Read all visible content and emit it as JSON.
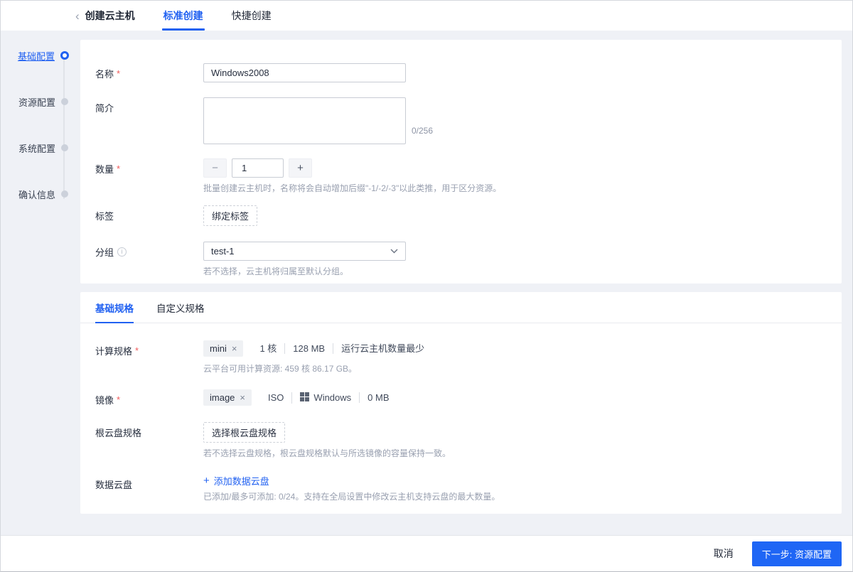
{
  "accent_color": "#2161f1",
  "required_mark": "*",
  "header": {
    "back_icon": "‹",
    "title": "创建云主机",
    "tabs": [
      {
        "label": "标准创建",
        "active": true
      },
      {
        "label": "快捷创建",
        "active": false
      }
    ]
  },
  "stepper": {
    "items": [
      {
        "label": "基础配置",
        "active": true
      },
      {
        "label": "资源配置",
        "active": false
      },
      {
        "label": "系统配置",
        "active": false
      },
      {
        "label": "确认信息",
        "active": false
      }
    ]
  },
  "form": {
    "name": {
      "label": "名称",
      "value": "Windows2008"
    },
    "description": {
      "label": "简介",
      "value": "",
      "counter": "0/256"
    },
    "quantity": {
      "label": "数量",
      "minus": "−",
      "value": "1",
      "plus": "+",
      "hint": "批量创建云主机时，名称将会自动增加后缀\"-1/-2/-3\"以此类推，用于区分资源。"
    },
    "tag": {
      "label": "标签",
      "button": "绑定标签"
    },
    "group": {
      "label": "分组",
      "info_icon": "i",
      "value": "test-1",
      "hint": "若不选择，云主机将归属至默认分组。"
    }
  },
  "spec_section": {
    "tabs": [
      {
        "label": "基础规格",
        "active": true
      },
      {
        "label": "自定义规格",
        "active": false
      }
    ],
    "compute": {
      "label": "计算规格",
      "tag": "mini",
      "remove_icon": "×",
      "specs": [
        "1 核",
        "128 MB",
        "运行云主机数量最少"
      ],
      "hint": "云平台可用计算资源: 459 核 86.17 GB。"
    },
    "image": {
      "label": "镜像",
      "tag": "image",
      "remove_icon": "×",
      "format": "ISO",
      "platform": "Windows",
      "size": "0 MB"
    },
    "root_disk": {
      "label": "根云盘规格",
      "button": "选择根云盘规格",
      "hint": "若不选择云盘规格，根云盘规格默认与所选镜像的容量保持一致。"
    },
    "data_disk": {
      "label": "数据云盘",
      "plus": "+",
      "add_link": "添加数据云盘",
      "hint": "已添加/最多可添加: 0/24。支持在全局设置中修改云主机支持云盘的最大数量。"
    }
  },
  "footer": {
    "cancel": "取消",
    "next": "下一步: 资源配置"
  }
}
